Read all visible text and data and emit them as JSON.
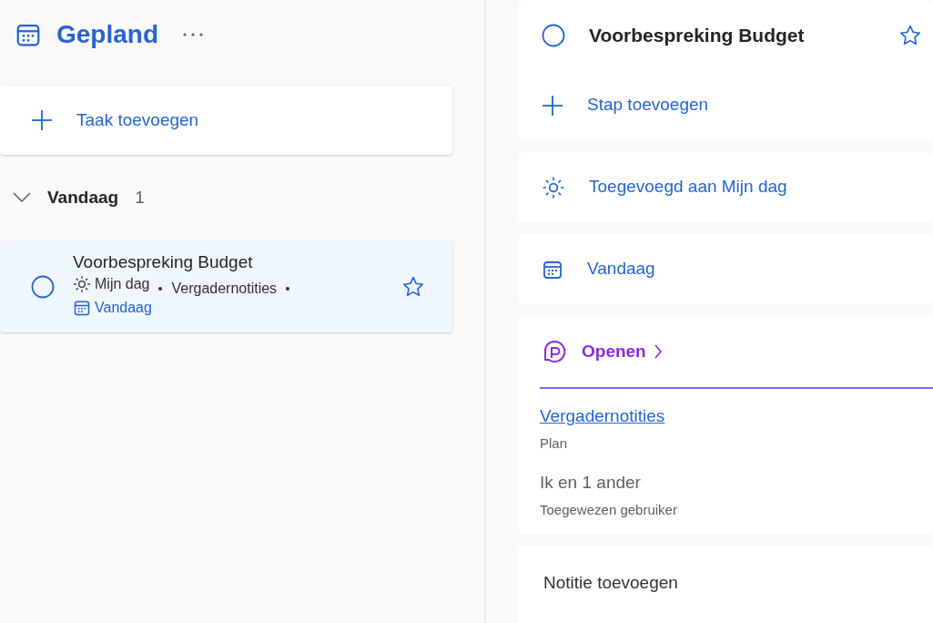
{
  "header": {
    "title": "Gepland"
  },
  "add_task": {
    "label": "Taak toevoegen"
  },
  "group": {
    "label": "Vandaag",
    "count": "1",
    "expanded": true
  },
  "tasks": [
    {
      "title": "Voorbespreking Budget",
      "completed": false,
      "selected": true,
      "important": false,
      "meta": [
        {
          "kind": "myday",
          "text": "Mijn dag"
        },
        {
          "kind": "list",
          "text": "Vergadernotities"
        },
        {
          "kind": "due",
          "text": "Vandaag"
        }
      ]
    }
  ],
  "detail": {
    "title": "Voorbespreking Budget",
    "completed": false,
    "important": false,
    "add_step": "Stap toevoegen",
    "my_day": "Toegevoegd aan Mijn dag",
    "due": "Vandaag",
    "open": "Openen",
    "plan_link": "Vergadernotities",
    "plan_caption": "Plan",
    "assigned": "Ik en 1 ander",
    "assigned_caption": "Toegewezen gebruiker",
    "note_placeholder": "Notitie toevoegen"
  }
}
